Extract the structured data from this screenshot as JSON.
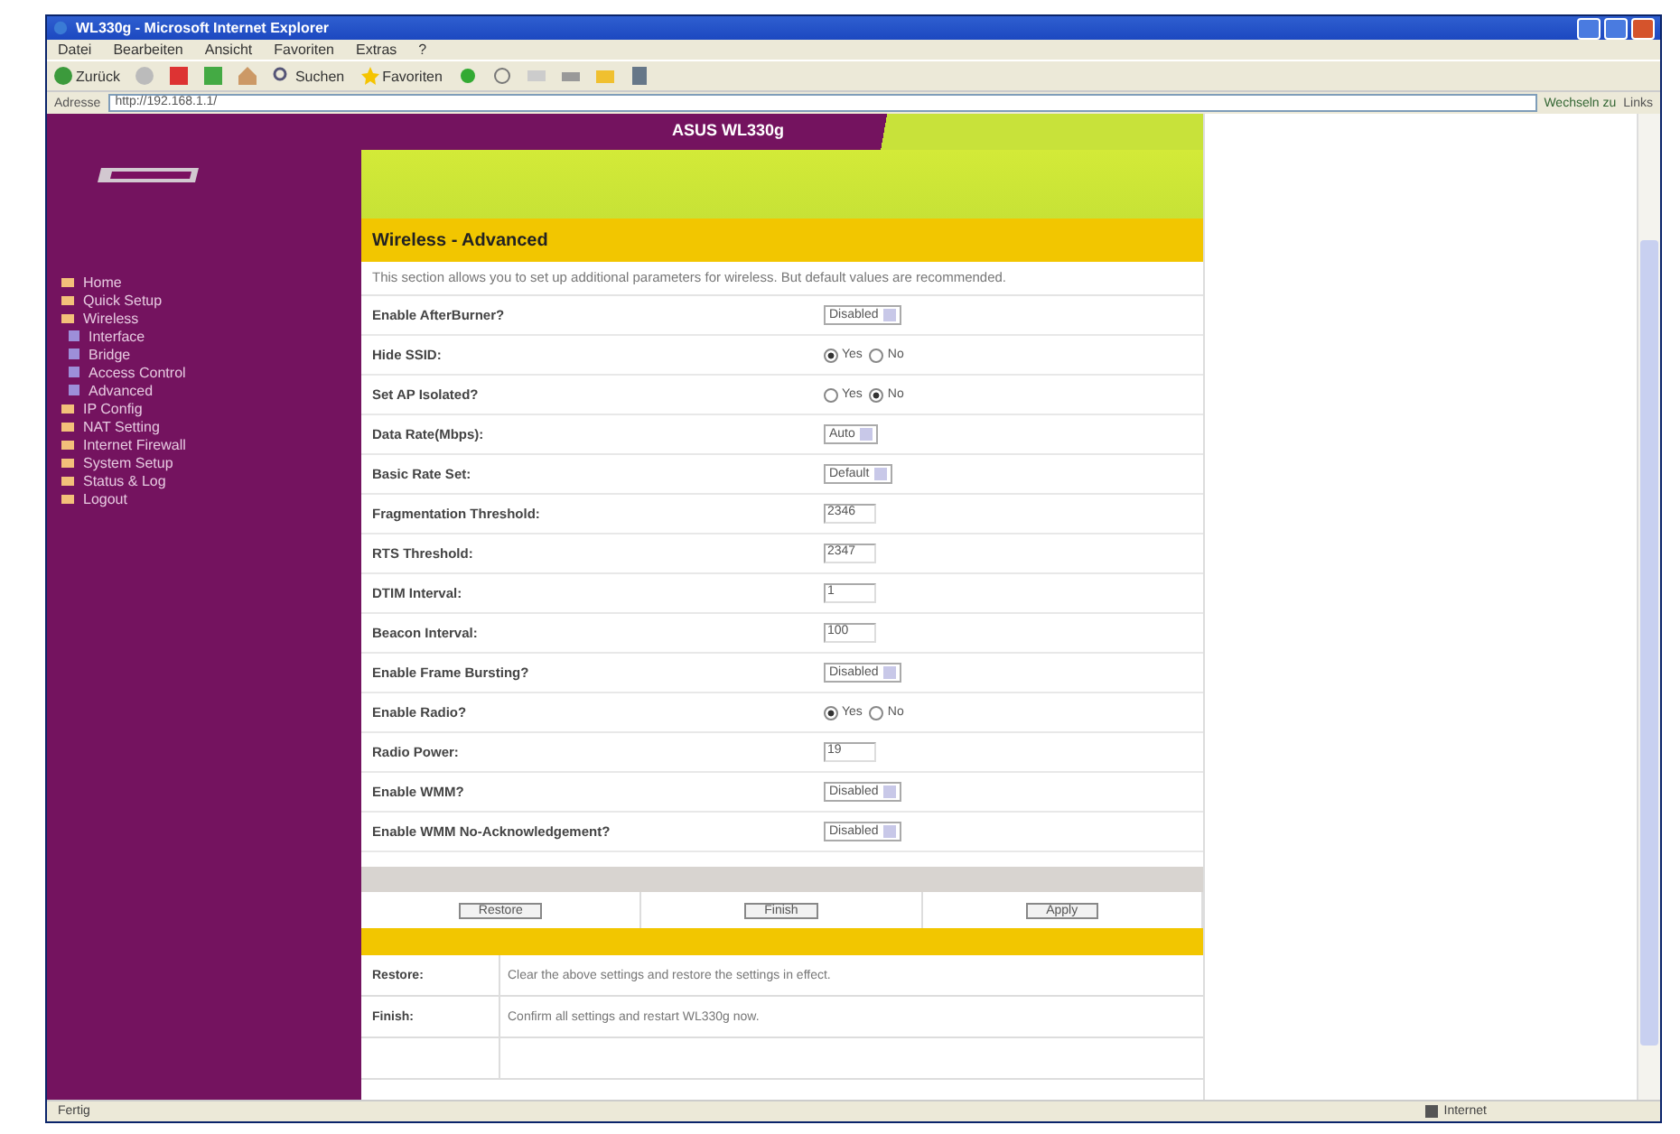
{
  "window": {
    "title": "WL330g - Microsoft Internet Explorer"
  },
  "menu": [
    "Datei",
    "Bearbeiten",
    "Ansicht",
    "Favoriten",
    "Extras",
    "?"
  ],
  "toolbar": {
    "back": "Zurück",
    "search": "Suchen",
    "favorites": "Favoriten"
  },
  "address_bar": {
    "label": "Adresse",
    "url": "http://192.168.1.1/",
    "go": "Wechseln zu",
    "links": "Links"
  },
  "sidebar": {
    "items": [
      {
        "label": "Home"
      },
      {
        "label": "Quick Setup"
      },
      {
        "label": "Wireless",
        "children": [
          {
            "label": "Interface"
          },
          {
            "label": "Bridge"
          },
          {
            "label": "Access Control"
          },
          {
            "label": "Advanced"
          }
        ]
      },
      {
        "label": "IP Config"
      },
      {
        "label": "NAT Setting"
      },
      {
        "label": "Internet Firewall"
      },
      {
        "label": "System Setup"
      },
      {
        "label": "Status & Log"
      },
      {
        "label": "Logout"
      }
    ]
  },
  "header": {
    "product": "ASUS WL330g",
    "section_title": "Wireless - Advanced",
    "intro": "This section allows you to set up additional parameters for wireless. But default values are recommended."
  },
  "settings": [
    {
      "label": "Enable AfterBurner?",
      "kind": "select",
      "value": "Disabled"
    },
    {
      "label": "Hide SSID:",
      "kind": "radio",
      "options": [
        {
          "label": "Yes",
          "selected": true
        },
        {
          "label": "No",
          "selected": false
        }
      ]
    },
    {
      "label": "Set AP Isolated?",
      "kind": "radio",
      "options": [
        {
          "label": "Yes",
          "selected": false
        },
        {
          "label": "No",
          "selected": true
        }
      ]
    },
    {
      "label": "Data Rate(Mbps):",
      "kind": "select",
      "value": "Auto"
    },
    {
      "label": "Basic Rate Set:",
      "kind": "select",
      "value": "Default"
    },
    {
      "label": "Fragmentation Threshold:",
      "kind": "text",
      "value": "2346"
    },
    {
      "label": "RTS Threshold:",
      "kind": "text",
      "value": "2347"
    },
    {
      "label": "DTIM Interval:",
      "kind": "text",
      "value": "1"
    },
    {
      "label": "Beacon Interval:",
      "kind": "text",
      "value": "100"
    },
    {
      "label": "Enable Frame Bursting?",
      "kind": "select",
      "value": "Disabled"
    },
    {
      "label": "Enable Radio?",
      "kind": "radio",
      "options": [
        {
          "label": "Yes",
          "selected": true
        },
        {
          "label": "No",
          "selected": false
        }
      ]
    },
    {
      "label": "Radio Power:",
      "kind": "text",
      "value": "19"
    },
    {
      "label": "Enable WMM?",
      "kind": "select",
      "value": "Disabled"
    },
    {
      "label": "Enable WMM No-Acknowledgement?",
      "kind": "select",
      "value": "Disabled"
    }
  ],
  "buttons": [
    "Restore",
    "Finish",
    "Apply"
  ],
  "button_help": [
    {
      "name": "Restore:",
      "text": "Clear the above settings and restore the settings in effect."
    },
    {
      "name": "Finish:",
      "text": "Confirm all settings and restart WL330g now."
    }
  ],
  "status_bar": {
    "left": "Fertig",
    "zone": "Internet"
  }
}
